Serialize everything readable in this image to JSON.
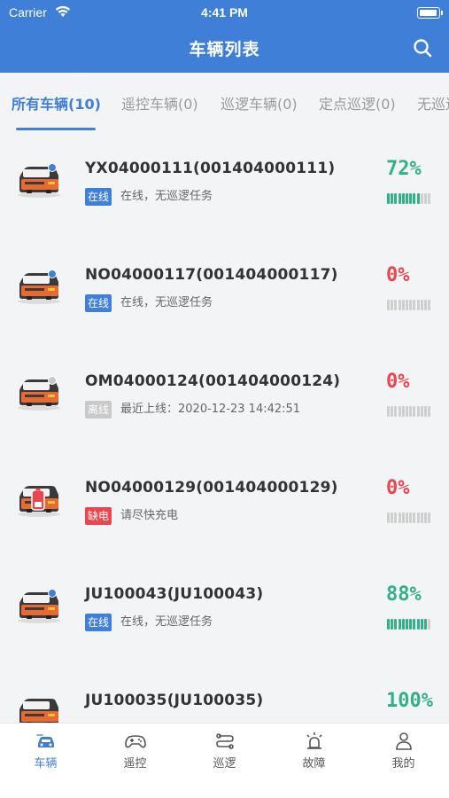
{
  "status_bar": {
    "carrier": "Carrier",
    "time": "4:41 PM"
  },
  "header": {
    "title": "车辆列表",
    "search_icon": "search-icon"
  },
  "tabs": [
    {
      "label": "所有车辆(10)",
      "active": true
    },
    {
      "label": "遥控车辆(0)",
      "active": false
    },
    {
      "label": "巡逻车辆(0)",
      "active": false
    },
    {
      "label": "定点巡逻(0)",
      "active": false
    },
    {
      "label": "无巡逻",
      "active": false
    }
  ],
  "vehicles": [
    {
      "name": "YX04000111(001404000111)",
      "badge": "在线",
      "badge_color": "#3f7fd7",
      "status_text": "在线，无巡逻任务",
      "percent": "72%",
      "battery_level": 0.72,
      "percent_color": "#33b08a",
      "dot_color": "#3f7fd7",
      "icon": "vehicle-icon"
    },
    {
      "name": "NO04000117(001404000117)",
      "badge": "在线",
      "badge_color": "#3f7fd7",
      "status_text": "在线，无巡逻任务",
      "percent": "0%",
      "battery_level": 0,
      "percent_color": "#e8474f",
      "dot_color": "#3f7fd7",
      "icon": "vehicle-icon"
    },
    {
      "name": "OM04000124(001404000124)",
      "badge": "离线",
      "badge_color": "#c9c9c9",
      "status_text": "最近上线：2020-12-23 14:42:51",
      "percent": "0%",
      "battery_level": 0,
      "percent_color": "#e8474f",
      "dot_color": "#c9c9c9",
      "icon": "vehicle-icon"
    },
    {
      "name": "NO04000129(001404000129)",
      "badge": "缺电",
      "badge_color": "#e8474f",
      "status_text": "请尽快充电",
      "percent": "0%",
      "battery_level": 0,
      "percent_color": "#e8474f",
      "dot_color": "",
      "icon": "low-battery-vehicle-icon"
    },
    {
      "name": "JU100043(JU100043)",
      "badge": "在线",
      "badge_color": "#3f7fd7",
      "status_text": "在线，无巡逻任务",
      "percent": "88%",
      "battery_level": 0.88,
      "percent_color": "#33b08a",
      "dot_color": "#3f7fd7",
      "icon": "vehicle-icon"
    },
    {
      "name": "JU100035(JU100035)",
      "badge": "",
      "badge_color": "#c9c9c9",
      "status_text": "",
      "percent": "100%",
      "battery_level": 1.0,
      "percent_color": "#33b08a",
      "dot_color": "",
      "icon": "vehicle-icon"
    }
  ],
  "tabbar": [
    {
      "label": "车辆",
      "icon": "car-icon",
      "active": true
    },
    {
      "label": "遥控",
      "icon": "gamepad-icon",
      "active": false
    },
    {
      "label": "巡逻",
      "icon": "route-icon",
      "active": false
    },
    {
      "label": "故障",
      "icon": "alarm-light-icon",
      "active": false
    },
    {
      "label": "我的",
      "icon": "user-icon",
      "active": false
    }
  ],
  "colors": {
    "primary": "#3f7fd7",
    "online": "#3f7fd7",
    "offline": "#c9c9c9",
    "warning": "#e8474f",
    "good": "#33b08a"
  }
}
